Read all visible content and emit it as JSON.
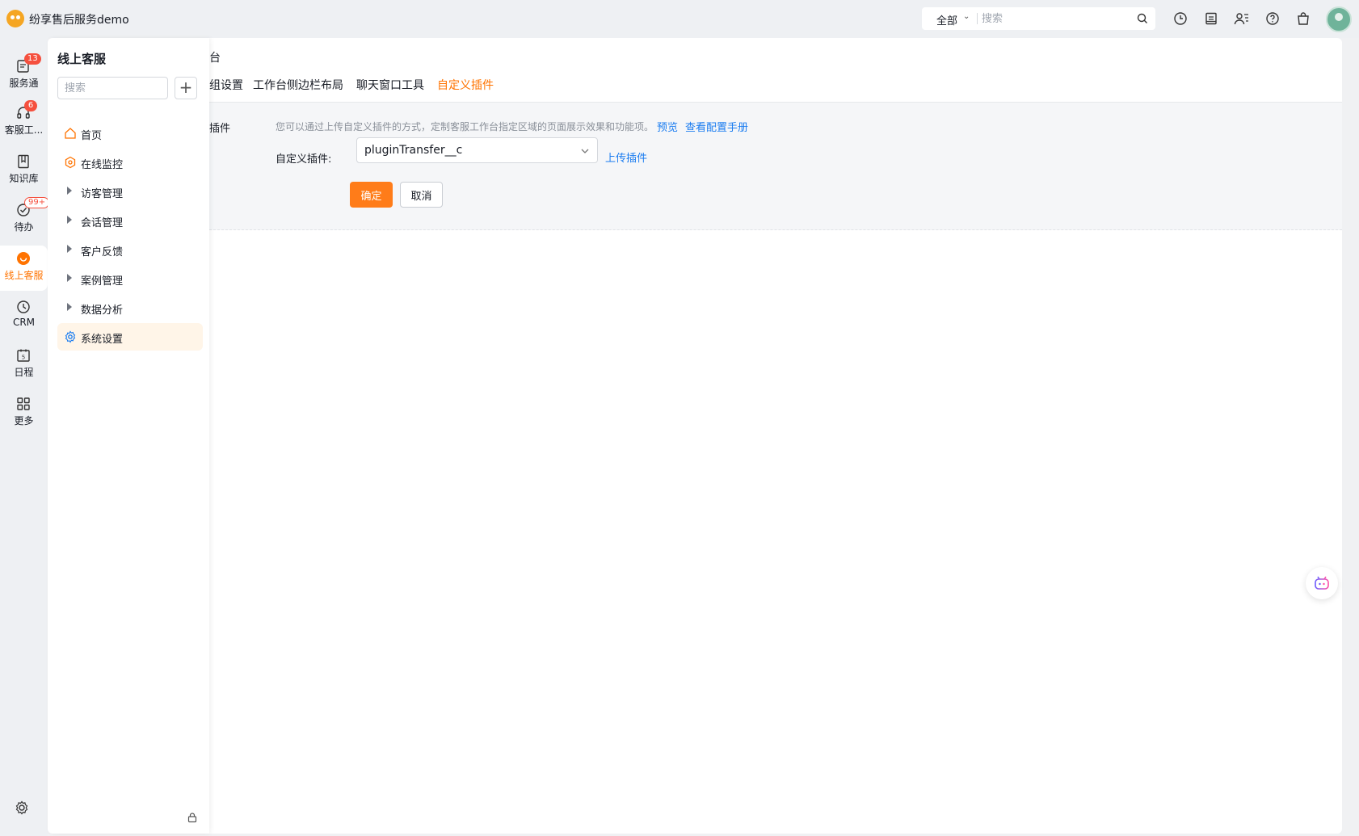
{
  "app": {
    "title": "纷享售后服务demo"
  },
  "topbar": {
    "scope": "全部",
    "search_placeholder": "搜索",
    "icons": [
      "clock-icon",
      "document-icon",
      "contacts-icon",
      "help-icon",
      "shopping-bag-icon"
    ]
  },
  "rail": {
    "items": [
      {
        "label": "服务通",
        "icon": "service-icon",
        "badge": "13"
      },
      {
        "label": "客服工...",
        "icon": "headset-icon",
        "badge": "6"
      },
      {
        "label": "知识库",
        "icon": "book-icon",
        "badge": ""
      },
      {
        "label": "待办",
        "icon": "check-circle-icon",
        "badge": "99+"
      },
      {
        "label": "线上客服",
        "icon": "online-service-icon",
        "badge": ""
      },
      {
        "label": "CRM",
        "icon": "crm-icon",
        "badge": ""
      },
      {
        "label": "日程",
        "icon": "calendar-icon",
        "badge": ""
      },
      {
        "label": "更多",
        "icon": "grid-icon",
        "badge": ""
      }
    ]
  },
  "sidemenu": {
    "title": "线上客服",
    "search_placeholder": "搜索",
    "add_label": "+",
    "items": [
      {
        "label": "首页",
        "icon": "home-icon"
      },
      {
        "label": "在线监控",
        "icon": "monitor-icon"
      },
      {
        "label": "访客管理",
        "icon": "caret-right-icon"
      },
      {
        "label": "会话管理",
        "icon": "caret-right-icon"
      },
      {
        "label": "客户反馈",
        "icon": "caret-right-icon"
      },
      {
        "label": "案例管理",
        "icon": "caret-right-icon"
      },
      {
        "label": "数据分析",
        "icon": "caret-right-icon"
      },
      {
        "label": "系统设置",
        "icon": "settings-icon"
      }
    ]
  },
  "main": {
    "crumb": "台",
    "tabs": [
      {
        "label": "组设置"
      },
      {
        "label": "工作台侧边栏布局"
      },
      {
        "label": "聊天窗口工具"
      },
      {
        "label": "自定义插件"
      }
    ],
    "active_tab": "自定义插件",
    "panel": {
      "label": "插件",
      "description": "您可以通过上传自定义插件的方式，定制客服工作台指定区域的页面展示效果和功能项。",
      "preview_link": "预览",
      "manual_link": "查看配置手册",
      "field_label": "自定义插件:",
      "select_value": "pluginTransfer__c",
      "upload_link": "上传插件",
      "ok_label": "确定",
      "cancel_label": "取消"
    }
  },
  "colors": {
    "accent": "#ff7300",
    "link": "#1a7cf0",
    "badge": "#f5503e"
  }
}
